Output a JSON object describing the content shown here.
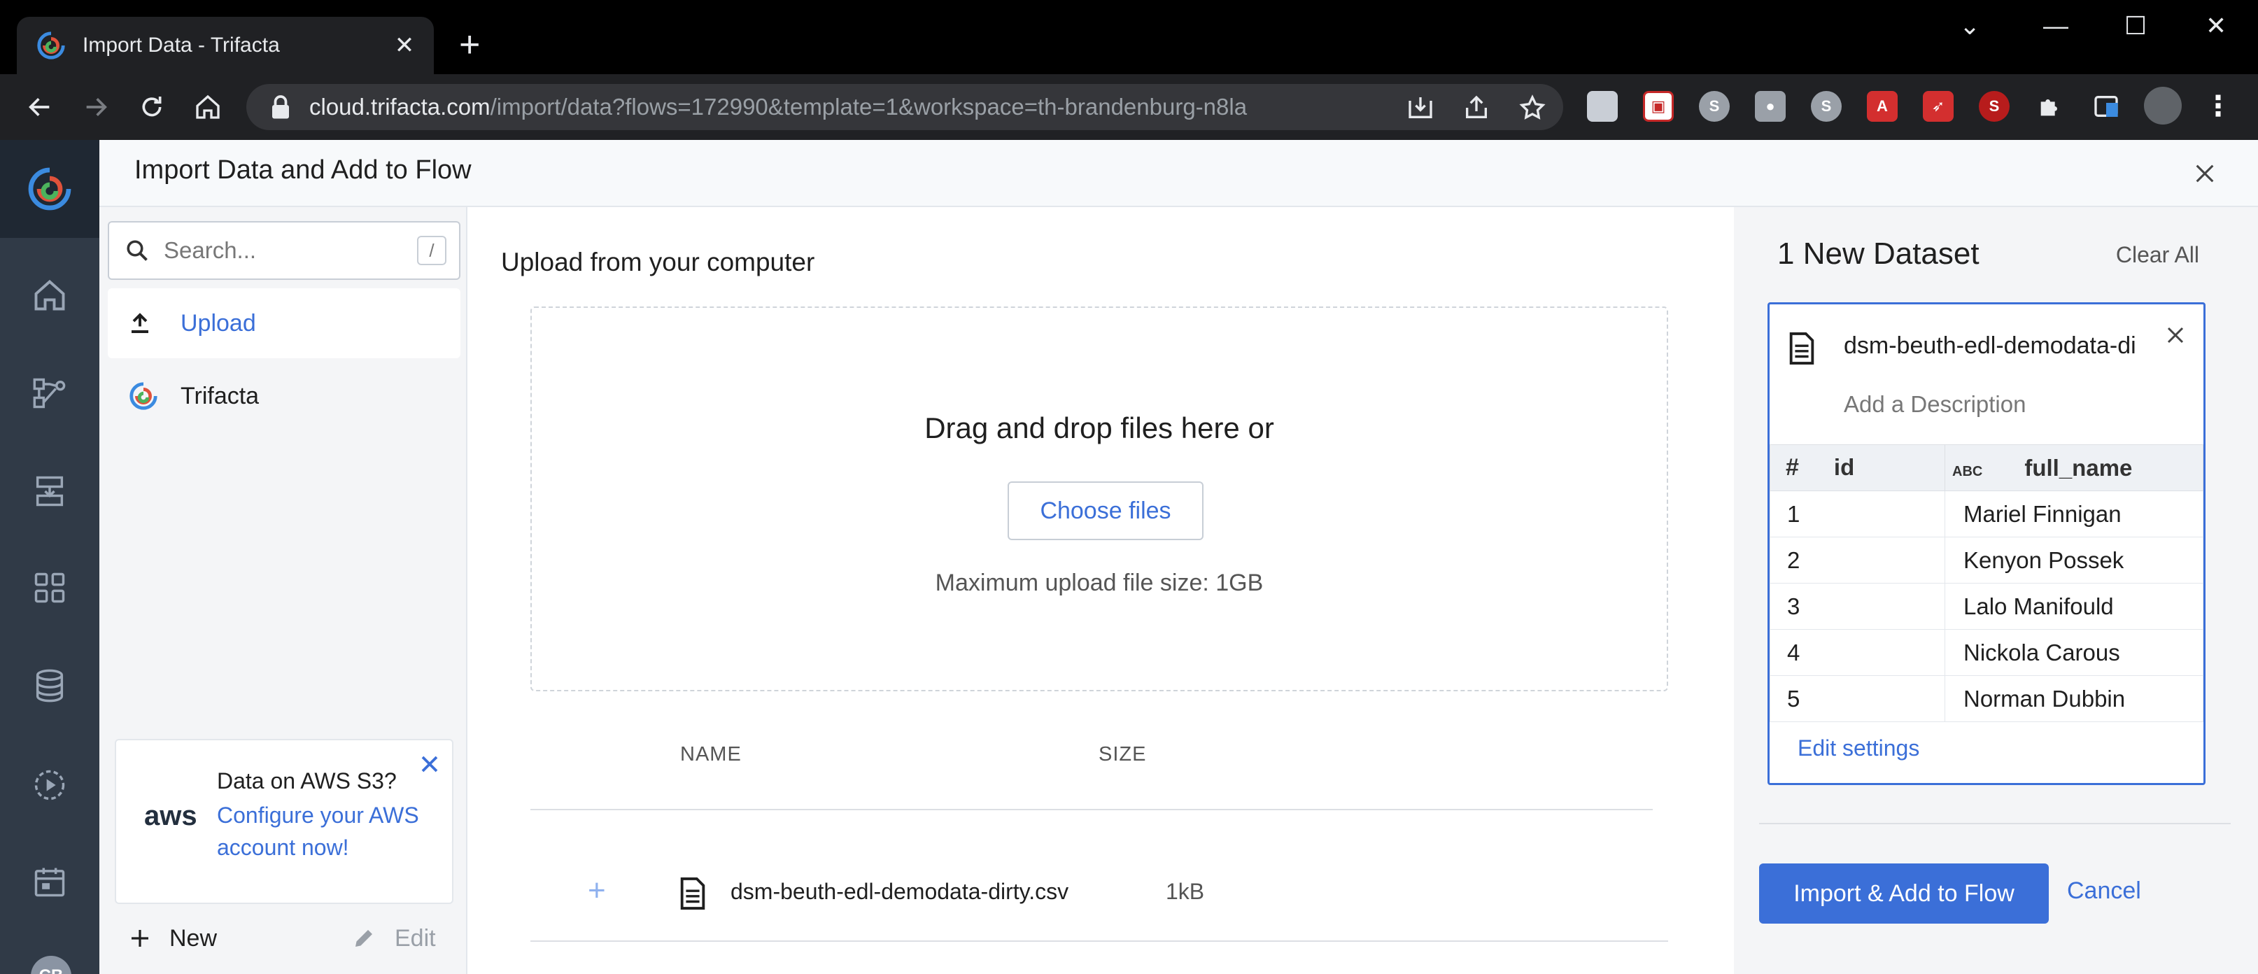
{
  "browser": {
    "tab_title": "Import Data - Trifacta",
    "url_host": "cloud.trifacta.com",
    "url_path": "/import/data?flows=172990&template=1&workspace=th-brandenburg-n8la"
  },
  "header": {
    "title": "Import Data and Add to Flow"
  },
  "sidebar": {
    "search_placeholder": "Search...",
    "search_shortcut": "/",
    "items": [
      {
        "label": "Upload",
        "active": true
      },
      {
        "label": "Trifacta",
        "active": false
      }
    ],
    "aws_card": {
      "logo_text": "aws",
      "title": "Data on AWS S3?",
      "link": "Configure your AWS account now!"
    },
    "new_label": "New",
    "edit_label": "Edit",
    "user_initials": "CB"
  },
  "main": {
    "upload_title": "Upload from your computer",
    "drop_text": "Drag and drop files here or",
    "choose_files": "Choose files",
    "max_size": "Maximum upload file size: 1GB",
    "columns": {
      "name": "NAME",
      "size": "SIZE"
    },
    "files": [
      {
        "name": "dsm-beuth-edl-demodata-dirty.csv",
        "size": "1kB"
      }
    ]
  },
  "right_panel": {
    "count_label": "1 New Dataset",
    "clear_all": "Clear All",
    "dataset": {
      "name": "dsm-beuth-edl-demodata-di",
      "description_placeholder": "Add a Description",
      "col1": {
        "type_icon": "#",
        "name": "id"
      },
      "col2": {
        "type_icon": "ABC",
        "name": "full_name"
      },
      "rows": [
        {
          "id": "1",
          "full_name": "Mariel Finnigan"
        },
        {
          "id": "2",
          "full_name": "Kenyon Possek"
        },
        {
          "id": "3",
          "full_name": "Lalo Manifould"
        },
        {
          "id": "4",
          "full_name": "Nickola Carous"
        },
        {
          "id": "5",
          "full_name": "Norman Dubbin"
        }
      ],
      "edit_settings": "Edit settings"
    },
    "import_button": "Import & Add to Flow",
    "cancel_button": "Cancel"
  },
  "colors": {
    "accent": "#3b6fd8",
    "nav_bg": "#303a47",
    "panel_bg": "#f4f5f7"
  }
}
